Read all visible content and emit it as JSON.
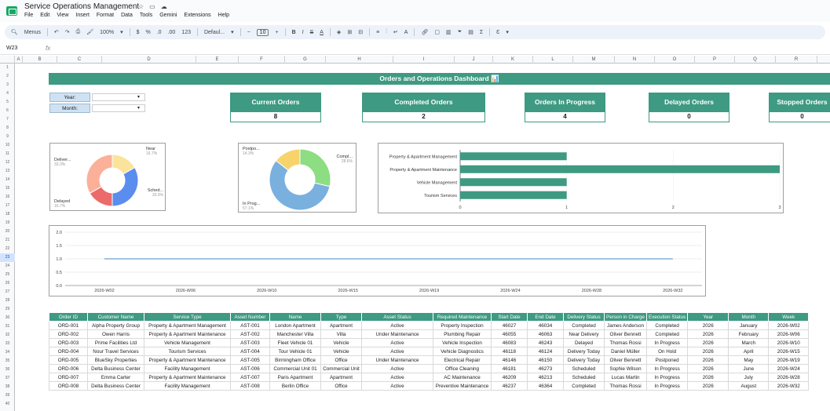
{
  "app": {
    "title": "Service Operations Management",
    "menu": [
      "File",
      "Edit",
      "View",
      "Insert",
      "Format",
      "Data",
      "Tools",
      "Gemini",
      "Extensions",
      "Help"
    ]
  },
  "toolbar": {
    "menus_label": "Menus",
    "zoom": "100%",
    "currency": "$",
    "percent": "%",
    "decimals_less": ".0",
    "decimals_more": ".00",
    "number_format": "123",
    "font": "Defaul...",
    "font_size": "10"
  },
  "formula_bar": {
    "cell_ref": "W23",
    "fx": "fx"
  },
  "columns": [
    "A",
    "B",
    "C",
    "D",
    "E",
    "F",
    "G",
    "H",
    "I",
    "J",
    "K",
    "L",
    "M",
    "N",
    "O",
    "P",
    "Q",
    "R"
  ],
  "rows": [
    "1",
    "2",
    "3",
    "4",
    "5",
    "6",
    "7",
    "8",
    "9",
    "10",
    "11",
    "12",
    "13",
    "14",
    "15",
    "16",
    "17",
    "18",
    "19",
    "20",
    "21",
    "22",
    "23",
    "24",
    "25",
    "26",
    "27",
    "28",
    "29",
    "30",
    "31",
    "32",
    "33",
    "34",
    "35",
    "36",
    "37",
    "38",
    "39",
    "40"
  ],
  "dashboard": {
    "title": "Orders and Operations Dashboard 📊",
    "filters": {
      "year_label": "Year:",
      "month_label": "Month:"
    },
    "cards": [
      {
        "title": "Current Orders",
        "value": "8"
      },
      {
        "title": "Completed Orders",
        "value": "2"
      },
      {
        "title": "Orders In Progress",
        "value": "4"
      },
      {
        "title": "Delayed Orders",
        "value": "0"
      },
      {
        "title": "Stopped Orders",
        "value": "0"
      }
    ]
  },
  "chart_data": [
    {
      "type": "pie",
      "donut": true,
      "labels": [
        "Near",
        "Sched...",
        "Delayed",
        "Deliver..."
      ],
      "pct_labels": [
        "16.7%",
        "33.3%",
        "16.7%",
        "33.3%"
      ],
      "values": [
        16.7,
        33.3,
        16.7,
        33.3
      ],
      "colors": [
        "#fbe39b",
        "#5b8def",
        "#ec6a6a",
        "#fbb09a"
      ]
    },
    {
      "type": "pie",
      "donut": true,
      "labels": [
        "Compl...",
        "In Prog...",
        "Postpo..."
      ],
      "pct_labels": [
        "28.6%",
        "57.1%",
        "14.3%"
      ],
      "values": [
        28.6,
        57.1,
        14.3
      ],
      "colors": [
        "#8ddd82",
        "#7ab0de",
        "#f6d36b"
      ]
    },
    {
      "type": "bar",
      "orientation": "horizontal",
      "categories": [
        "Property & Apartment Management",
        "Property & Apartment Maintenance",
        "Vehicle Management",
        "Tourism Services"
      ],
      "values": [
        1,
        3,
        1,
        1
      ],
      "xlim": [
        0,
        3
      ],
      "xticks": [
        "0",
        "1",
        "2",
        "3"
      ],
      "color": "#3e9a82"
    },
    {
      "type": "line",
      "x": [
        "2026-W02",
        "2026-W06",
        "2026-W10",
        "2026-W15",
        "2026-W19",
        "2026-W24",
        "2026-W28",
        "2026-W32"
      ],
      "values": [
        1,
        1,
        1,
        1,
        1,
        1,
        1,
        1
      ],
      "ylim": [
        0,
        2
      ],
      "yticks": [
        "0.0",
        "0.5",
        "1.0",
        "1.5",
        "2.0"
      ],
      "color": "#4a86c8"
    }
  ],
  "table": {
    "headers": [
      "Order ID",
      "Customer Name",
      "Service Type",
      "Asset Number",
      "Name",
      "Type",
      "Asset Status",
      "Required Maintenance",
      "Start Date",
      "End Date",
      "Delivery Status",
      "Person in Charge",
      "Execution Status",
      "Year",
      "Month",
      "Week"
    ],
    "rows": [
      [
        "ORD-001",
        "Alpha Property Group",
        "Property & Apartment Management",
        "AST-001",
        "London Apartment",
        "Apartment",
        "Active",
        "Property Inspection",
        "46027",
        "46034",
        "Completed",
        "James Anderson",
        "Completed",
        "2026",
        "January",
        "2026-W02"
      ],
      [
        "ORD-002",
        "Owen Harris",
        "Property & Apartment Maintenance",
        "AST-002",
        "Manchester Villa",
        "Villa",
        "Under Maintenance",
        "Plumbing Repair",
        "46055",
        "46063",
        "Near Delivery",
        "Oliver Bennett",
        "Completed",
        "2026",
        "February",
        "2026-W06"
      ],
      [
        "ORD-003",
        "Prime Facilities Ltd",
        "Vehicle Management",
        "AST-003",
        "Fleet Vehicle 01",
        "Vehicle",
        "Active",
        "Vehicle Inspection",
        "46083",
        "46243",
        "Delayed",
        "Thomas Rossi",
        "In Progress",
        "2026",
        "March",
        "2026-W10"
      ],
      [
        "ORD-004",
        "Nour Travel Services",
        "Tourism Services",
        "AST-004",
        "Tour Vehicle 01",
        "Vehicle",
        "Active",
        "Vehicle Diagnostics",
        "46118",
        "46124",
        "Delivery Today",
        "Daniel Müller",
        "On Hold",
        "2026",
        "April",
        "2026-W15"
      ],
      [
        "ORD-005",
        "BlueSky Properties",
        "Property & Apartment Maintenance",
        "AST-005",
        "Birmingham Office",
        "Office",
        "Under Maintenance",
        "Electrical Repair",
        "46146",
        "46150",
        "Delivery Today",
        "Oliver Bennett",
        "Postponed",
        "2026",
        "May",
        "2026-W19"
      ],
      [
        "ORD-006",
        "Delta Business Center",
        "Facility Management",
        "AST-006",
        "Commercial Unit 01",
        "Commercial Unit",
        "Active",
        "Office Cleaning",
        "46181",
        "46273",
        "Scheduled",
        "Sophie Wilson",
        "In Progress",
        "2026",
        "June",
        "2026-W24"
      ],
      [
        "ORD-007",
        "Emma Carter",
        "Property & Apartment Maintenance",
        "AST-007",
        "Paris Apartment",
        "Apartment",
        "Active",
        "AC Maintenance",
        "46209",
        "46213",
        "Scheduled",
        "Lucas Martin",
        "In Progress",
        "2026",
        "July",
        "2026-W28"
      ],
      [
        "ORD-008",
        "Delta Business Center",
        "Facility Management",
        "AST-008",
        "Berlin Office",
        "Office",
        "Active",
        "Preventive Maintenance",
        "46237",
        "46364",
        "Completed",
        "Thomas Rossi",
        "In Progress",
        "2026",
        "August",
        "2026-W32"
      ]
    ]
  }
}
